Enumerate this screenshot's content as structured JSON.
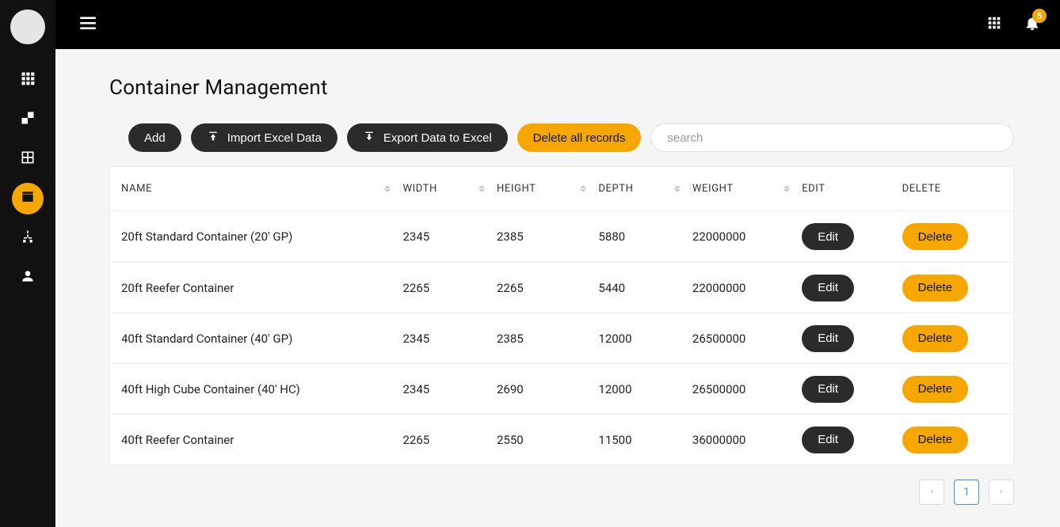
{
  "page": {
    "title": "Container Management"
  },
  "header": {
    "notification_count": "5"
  },
  "toolbar": {
    "add": "Add",
    "import": "Import Excel Data",
    "export": "Export Data to Excel",
    "delete_all": "Delete all records",
    "search_placeholder": "search"
  },
  "table": {
    "headers": {
      "name": "NAME",
      "width": "WIDTH",
      "height": "HEIGHT",
      "depth": "DEPTH",
      "weight": "WEIGHT",
      "edit": "EDIT",
      "delete": "DELETE"
    },
    "edit_label": "Edit",
    "delete_label": "Delete",
    "rows": [
      {
        "name": "20ft Standard Container (20' GP)",
        "width": "2345",
        "height": "2385",
        "depth": "5880",
        "weight": "22000000"
      },
      {
        "name": "20ft Reefer Container",
        "width": "2265",
        "height": "2265",
        "depth": "5440",
        "weight": "22000000"
      },
      {
        "name": "40ft Standard Container (40' GP)",
        "width": "2345",
        "height": "2385",
        "depth": "12000",
        "weight": "26500000"
      },
      {
        "name": "40ft High Cube Container (40' HC)",
        "width": "2345",
        "height": "2690",
        "depth": "12000",
        "weight": "26500000"
      },
      {
        "name": "40ft Reefer Container",
        "width": "2265",
        "height": "2550",
        "depth": "11500",
        "weight": "36000000"
      }
    ]
  },
  "pagination": {
    "current": "1"
  }
}
